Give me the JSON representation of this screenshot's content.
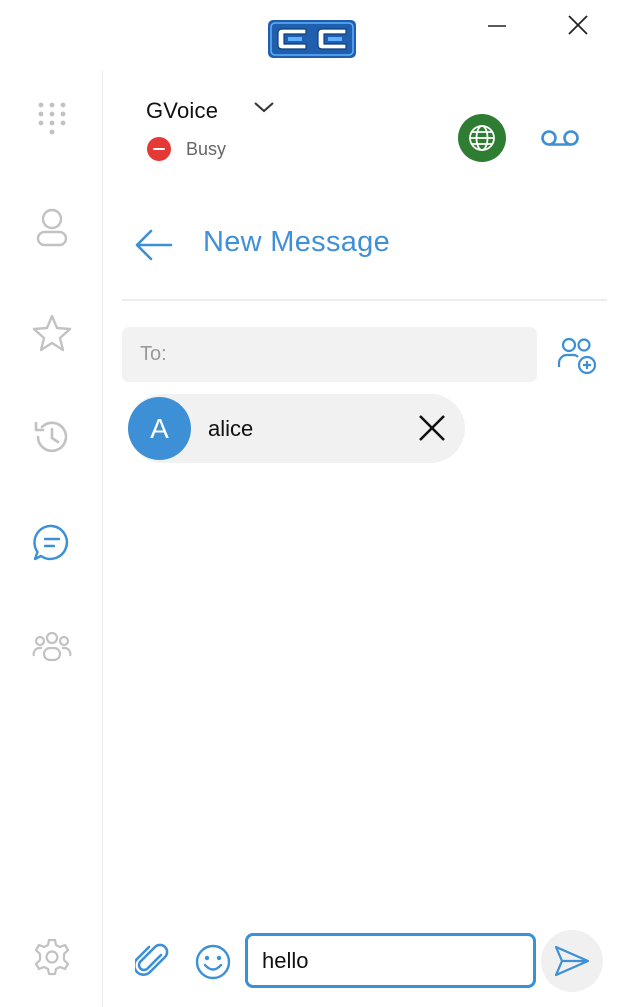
{
  "titlebar": {
    "logo_text": "CC",
    "logo_icon": "cc-logo-icon",
    "minimize_icon": "minimize-icon",
    "close_icon": "close-icon"
  },
  "sidebar": {
    "items": [
      {
        "id": "dialpad",
        "icon": "dialpad-icon",
        "active": false
      },
      {
        "id": "contacts",
        "icon": "contact-icon",
        "active": false
      },
      {
        "id": "favorites",
        "icon": "star-icon",
        "active": false
      },
      {
        "id": "history",
        "icon": "history-icon",
        "active": false
      },
      {
        "id": "messages",
        "icon": "chat-icon",
        "active": true
      },
      {
        "id": "groups",
        "icon": "group-icon",
        "active": false
      },
      {
        "id": "settings",
        "icon": "gear-icon",
        "active": false
      }
    ]
  },
  "account": {
    "name": "GVoice",
    "status": "Busy",
    "status_color": "#e53935"
  },
  "header": {
    "globe_color": "#2e7d32",
    "globe_icon": "globe-icon",
    "voicemail_icon": "voicemail-icon"
  },
  "page": {
    "title": "New Message",
    "back_icon": "back-arrow-icon"
  },
  "compose": {
    "to_label": "To:",
    "add_contact_icon": "add-contact-icon",
    "recipients": [
      {
        "initial": "A",
        "name": "alice"
      }
    ],
    "message_value": "hello",
    "attach_icon": "paperclip-icon",
    "emoji_icon": "emoji-icon",
    "send_icon": "send-icon"
  },
  "colors": {
    "accent": "#3d8fd6",
    "title_blue": "#3f90d8",
    "icon_gray": "#bcbcbc"
  }
}
